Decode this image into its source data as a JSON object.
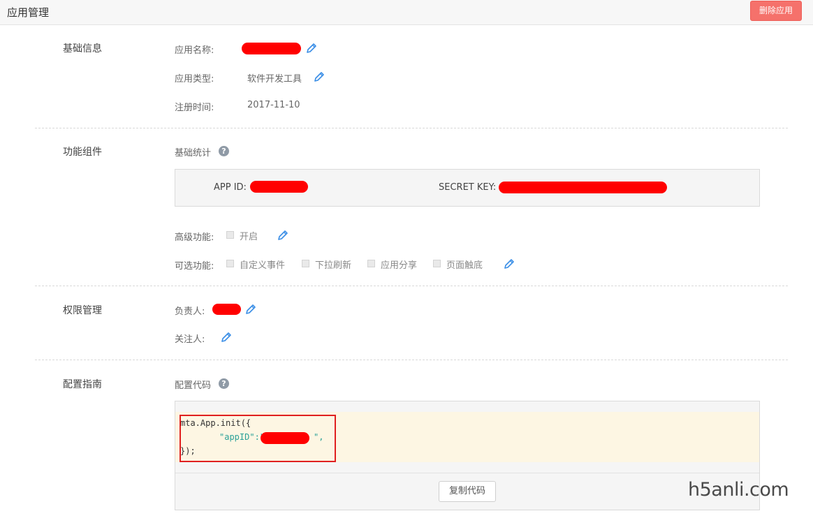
{
  "header": {
    "title": "应用管理",
    "delete_label": "删除应用"
  },
  "basic_info": {
    "section_title": "基础信息",
    "app_name_label": "应用名称:",
    "app_type_label": "应用类型:",
    "app_type_value": "软件开发工具",
    "register_time_label": "注册时间:",
    "register_time_value": "2017-11-10"
  },
  "components": {
    "section_title": "功能组件",
    "basic_stats_label": "基础统计",
    "app_id_label": "APP ID:",
    "secret_key_label": "SECRET KEY:",
    "advanced_label": "高级功能:",
    "advanced_option": "开启",
    "optional_label": "可选功能:",
    "optional_options": [
      "自定义事件",
      "下拉刷新",
      "应用分享",
      "页面触底"
    ]
  },
  "permissions": {
    "section_title": "权限管理",
    "owner_label": "负责人:",
    "follower_label": "关注人:"
  },
  "config": {
    "section_title": "配置指南",
    "code_label": "配置代码",
    "code_line1": "mta.App.init({",
    "code_key": "\"appID\"",
    "code_colon": ":\"",
    "code_tail": "\",",
    "code_line3": "});",
    "copy_label": "复制代码"
  },
  "watermark": "h5anli.com",
  "colors": {
    "danger": "#f5716b",
    "redaction": "#ff0000",
    "icon_blue": "#3a8ee6",
    "code_bg": "#fdf6e3"
  },
  "icons": [
    "pencil-icon",
    "question-icon"
  ]
}
